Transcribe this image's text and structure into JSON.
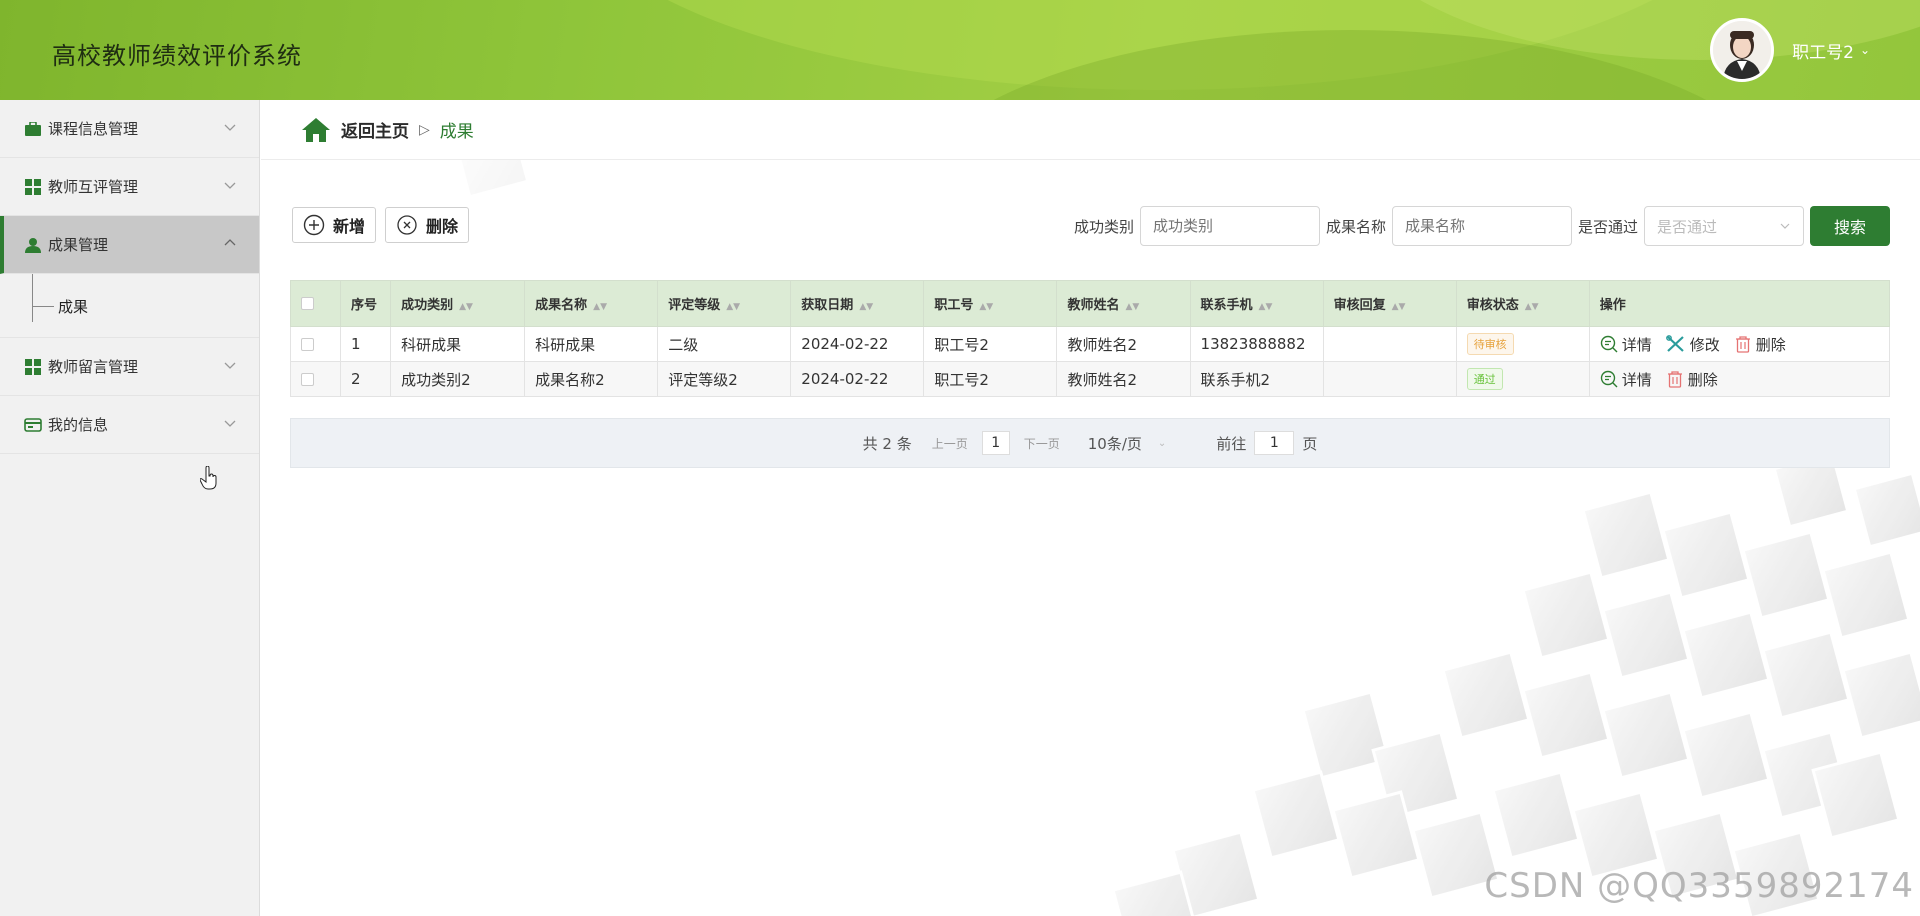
{
  "header": {
    "title": "高校教师绩效评价系统",
    "user_name": "职工号2"
  },
  "sidebar": {
    "items": [
      {
        "label": "课程信息管理",
        "icon": "briefcase-icon"
      },
      {
        "label": "教师互评管理",
        "icon": "grid-icon"
      },
      {
        "label": "成果管理",
        "icon": "user-icon",
        "active": true
      },
      {
        "label": "教师留言管理",
        "icon": "grid-icon"
      },
      {
        "label": "我的信息",
        "icon": "id-card-icon"
      }
    ],
    "submenu": {
      "label": "成果"
    }
  },
  "breadcrumb": {
    "home": "返回主页",
    "separator": "▷",
    "current": "成果"
  },
  "toolbar": {
    "add_label": "新增",
    "delete_label": "删除"
  },
  "search": {
    "field1_label": "成功类别",
    "field1_placeholder": "成功类别",
    "field2_label": "成果名称",
    "field2_placeholder": "成果名称",
    "field3_label": "是否通过",
    "field3_placeholder": "是否通过",
    "button": "搜索"
  },
  "table": {
    "columns": [
      "序号",
      "成功类别",
      "成果名称",
      "评定等级",
      "获取日期",
      "职工号",
      "教师姓名",
      "联系手机",
      "审核回复",
      "审核状态",
      "操作"
    ],
    "rows": [
      {
        "index": "1",
        "category": "科研成果",
        "name": "科研成果",
        "grade": "二级",
        "date": "2024-02-22",
        "staff_no": "职工号2",
        "teacher": "教师姓名2",
        "phone": "13823888882",
        "reply": "",
        "status": "待审核"
      },
      {
        "index": "2",
        "category": "成功类别2",
        "name": "成果名称2",
        "grade": "评定等级2",
        "date": "2024-02-22",
        "staff_no": "职工号2",
        "teacher": "教师姓名2",
        "phone": "联系手机2",
        "reply": "",
        "status": "通过"
      }
    ],
    "ops": {
      "detail": "详情",
      "edit": "修改",
      "delete": "删除"
    }
  },
  "pagination": {
    "total": "共 2 条",
    "prev": "上一页",
    "page": "1",
    "next": "下一页",
    "page_size": "10条/页",
    "goto_prefix": "前往",
    "goto_value": "1",
    "goto_suffix": "页"
  },
  "watermark": "CSDN @QQ3359892174",
  "colors": {
    "primary": "#2e7d32",
    "header_green": "#8fc53a",
    "table_header": "#dcebd5",
    "pending": "#e6a23c",
    "pass": "#67c23a"
  }
}
